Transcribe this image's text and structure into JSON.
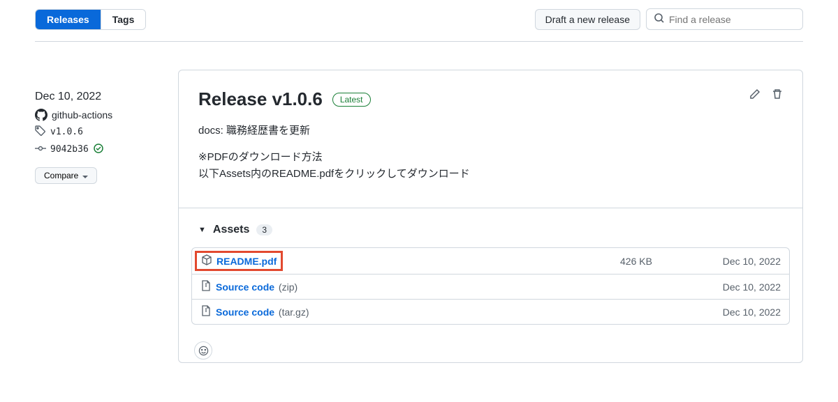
{
  "tabs": {
    "releases": "Releases",
    "tags": "Tags"
  },
  "top": {
    "draft": "Draft a new release",
    "search_placeholder": "Find a release"
  },
  "sidebar": {
    "date": "Dec 10, 2022",
    "author": "github-actions",
    "tag": "v1.0.6",
    "commit": "9042b36",
    "compare": "Compare"
  },
  "release": {
    "title": "Release v1.0.6",
    "badge": "Latest",
    "body_line1": "docs: 職務経歴書を更新",
    "body_line2": "※PDFのダウンロード方法",
    "body_line3": "以下Assets内のREADME.pdfをクリックしてダウンロード"
  },
  "assets": {
    "label": "Assets",
    "count": "3",
    "items": [
      {
        "name": "README.pdf",
        "suffix": "",
        "size": "426 KB",
        "date": "Dec 10, 2022"
      },
      {
        "name": "Source code",
        "suffix": "(zip)",
        "size": "",
        "date": "Dec 10, 2022"
      },
      {
        "name": "Source code",
        "suffix": "(tar.gz)",
        "size": "",
        "date": "Dec 10, 2022"
      }
    ]
  }
}
